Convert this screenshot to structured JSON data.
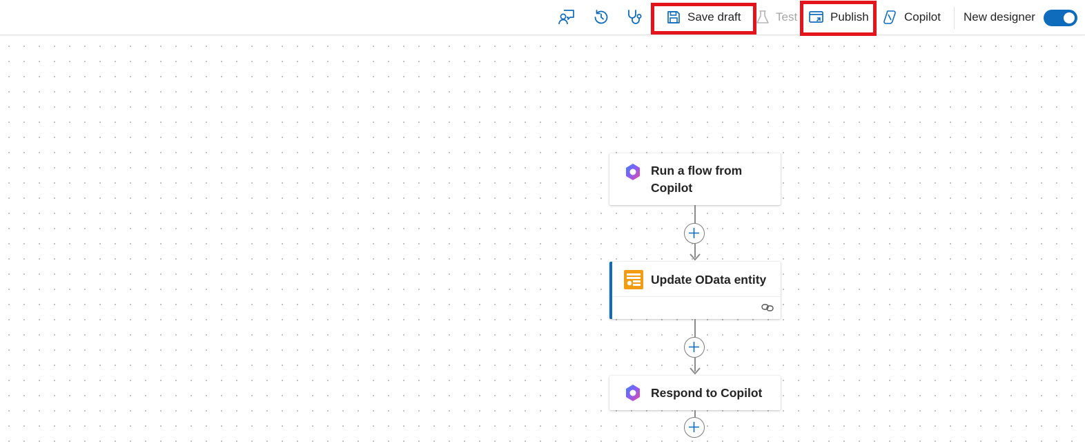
{
  "toolbar": {
    "feedback_icon": "person-feedback-icon",
    "history_icon": "history-icon",
    "checker_icon": "stethoscope-icon",
    "save_draft_label": "Save draft",
    "save_draft_icon": "save-icon",
    "test_label": "Test",
    "test_icon": "beaker-icon",
    "publish_label": "Publish",
    "publish_icon": "publish-icon",
    "copilot_label": "Copilot",
    "copilot_icon": "copilot-icon",
    "new_designer_label": "New designer",
    "new_designer_enabled": true
  },
  "flow": {
    "steps": [
      {
        "title_line1": "Run a flow from",
        "title_line2": "Copilot",
        "icon": "copilot-studio-icon"
      },
      {
        "title": "Update OData entity",
        "icon": "odata-icon",
        "footer_icon": "link-icon",
        "selected": true
      },
      {
        "title": "Respond to Copilot",
        "icon": "copilot-studio-icon"
      }
    ]
  },
  "colors": {
    "accent": "#0f6cbd",
    "highlight": "#e3141c",
    "odata_orange": "#f39c12",
    "disabled_text": "#a6a6a6"
  }
}
